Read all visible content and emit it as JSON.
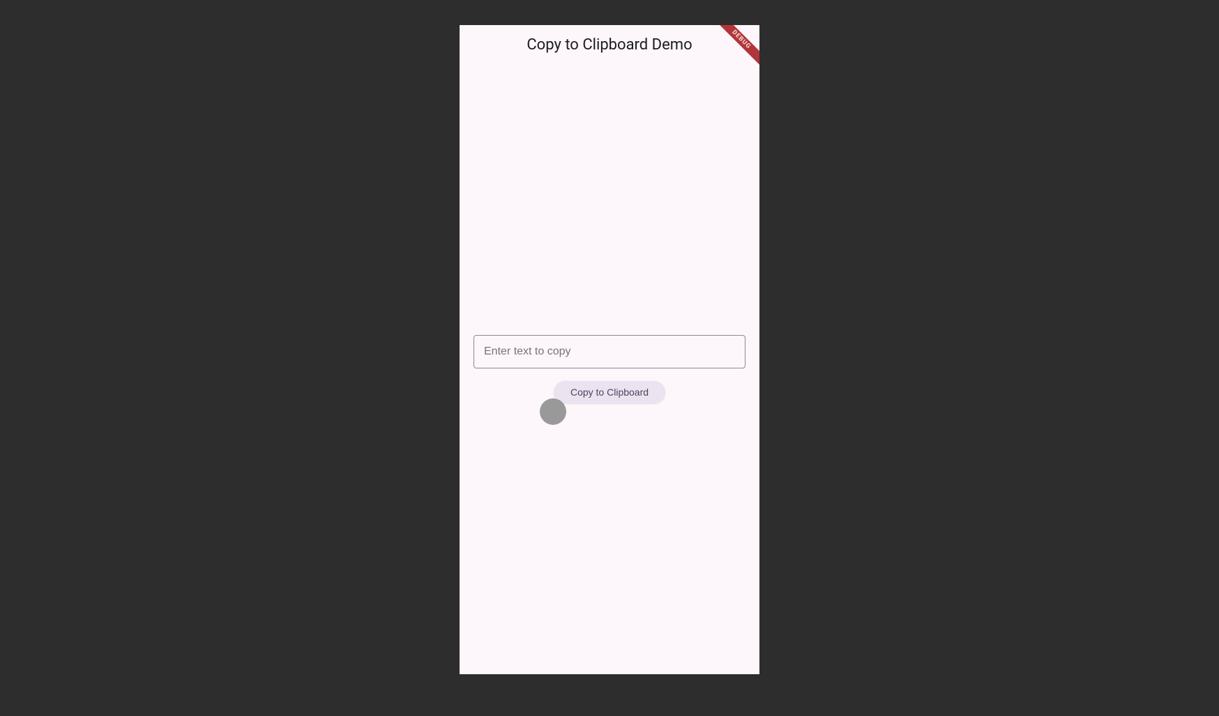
{
  "app": {
    "title": "Copy to Clipboard Demo"
  },
  "debug": {
    "label": "DEBUG"
  },
  "main": {
    "input_placeholder": "Enter text to copy",
    "input_value": "",
    "copy_button_label": "Copy to Clipboard"
  }
}
